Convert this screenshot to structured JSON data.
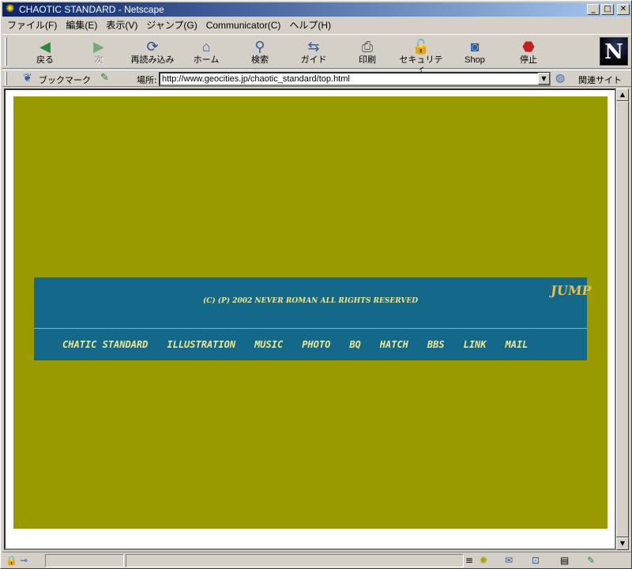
{
  "window": {
    "title": "CHAOTIC STANDARD - Netscape"
  },
  "menu": [
    "ファイル(F)",
    "編集(E)",
    "表示(V)",
    "ジャンプ(G)",
    "Communicator(C)",
    "ヘルプ(H)"
  ],
  "toolbar": {
    "back": "戻る",
    "forward": "次",
    "reload": "再読み込み",
    "home": "ホーム",
    "search": "検索",
    "guide": "ガイド",
    "print": "印刷",
    "security": "セキュリティ",
    "shop": "Shop",
    "stop": "停止"
  },
  "location": {
    "bookmarks": "ブックマーク",
    "label": "場所:",
    "url": "http://www.geocities.jp/chaotic_standard/top.html",
    "related": "関連サイト"
  },
  "page": {
    "copyright": "(C) (P) 2002 NEVER ROMAN ALL RIGHTS RESERVED",
    "logo": [
      "JUMP"
    ],
    "nav": [
      "CHATIC STANDARD",
      "ILLUSTRATION",
      "MUSIC",
      "PHOTO",
      "BQ",
      "HATCH",
      "BBS",
      "LINK",
      "MAIL"
    ]
  },
  "colors": {
    "page_bg": "#999900",
    "banner_bg": "#14688a",
    "nav_text": "#f0e68c"
  }
}
